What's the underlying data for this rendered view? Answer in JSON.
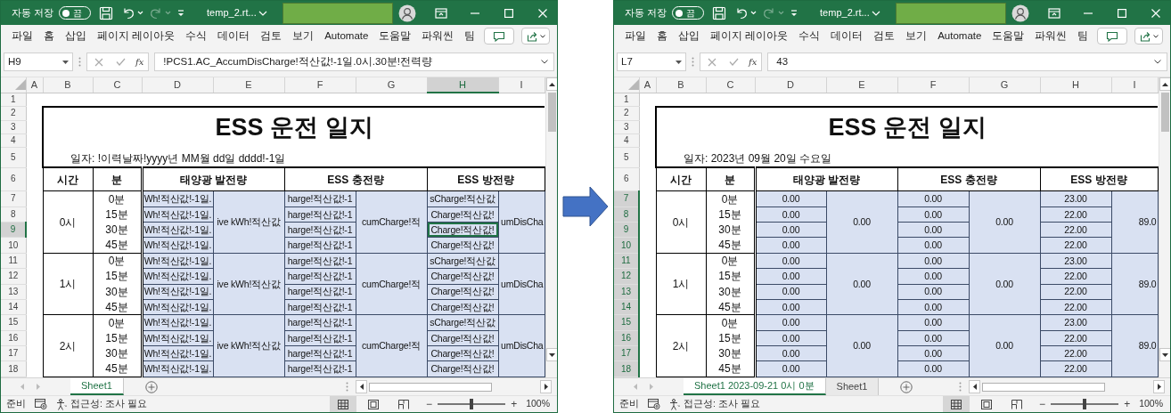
{
  "windows": [
    {
      "title_bar": {
        "autosave_label": "자동 저장",
        "autosave_state": "끔",
        "autosave_on": false,
        "redo_disabled": true,
        "filename": "temp_2.rt..."
      },
      "menu": [
        "파일",
        "홈",
        "삽입",
        "페이지 레이아웃",
        "수식",
        "데이터",
        "검토",
        "보기",
        "Automate",
        "도움말",
        "파워씬",
        "팀"
      ],
      "formula_bar": {
        "name_box": "H9",
        "fx": "fx",
        "formula": "!PCS1.AC_AccumDisCharge!적산값!-1일.0시.30분!전력량"
      },
      "columns": [
        {
          "label": "A",
          "selected": false
        },
        {
          "label": "B",
          "selected": false
        },
        {
          "label": "C",
          "selected": false
        },
        {
          "label": "D",
          "selected": false
        },
        {
          "label": "E",
          "selected": false
        },
        {
          "label": "F",
          "selected": false
        },
        {
          "label": "G",
          "selected": false
        },
        {
          "label": "H",
          "selected": true
        },
        {
          "label": "I",
          "selected": false
        }
      ],
      "rows": [
        {
          "label": "1",
          "selected": false
        },
        {
          "label": "2",
          "selected": false
        },
        {
          "label": "3",
          "selected": false
        },
        {
          "label": "4",
          "selected": false
        },
        {
          "label": "5",
          "selected": false
        },
        {
          "label": "6",
          "selected": false
        },
        {
          "label": "7",
          "selected": false
        },
        {
          "label": "8",
          "selected": false
        },
        {
          "label": "9",
          "selected": true
        },
        {
          "label": "10",
          "selected": false
        },
        {
          "label": "11",
          "selected": false
        },
        {
          "label": "12",
          "selected": false
        },
        {
          "label": "13",
          "selected": false
        },
        {
          "label": "14",
          "selected": false
        },
        {
          "label": "15",
          "selected": false
        },
        {
          "label": "16",
          "selected": false
        },
        {
          "label": "17",
          "selected": false
        },
        {
          "label": "18",
          "selected": false
        }
      ],
      "sheet": {
        "title": "ESS 운전 일지",
        "date_line": "일자: !이력날짜!yyyy년 MM월 dd일 dddd!-1일",
        "headers": [
          "시간",
          "분",
          "태양광 발전량",
          "ESS 충전량",
          "ESS 방전량"
        ],
        "groups": [
          {
            "hour": "0시",
            "totals": [
              "ive kWh!적산값",
              "cumCharge!적",
              "umDisCha"
            ],
            "quarters": [
              {
                "minute": "0분",
                "values": [
                  {
                    "text": "Wh!적산값!-1일.",
                    "active": false
                  },
                  {
                    "text": "harge!적산값!-1",
                    "active": false
                  },
                  {
                    "text": "sCharge!적산값",
                    "active": false
                  }
                ]
              },
              {
                "minute": "15분",
                "values": [
                  {
                    "text": "Wh!적산값!-1일.",
                    "active": false
                  },
                  {
                    "text": "harge!적산값!-1",
                    "active": false
                  },
                  {
                    "text": "Charge!적산값!",
                    "active": false
                  }
                ]
              },
              {
                "minute": "30분",
                "values": [
                  {
                    "text": "Wh!적산값!-1일.",
                    "active": false
                  },
                  {
                    "text": "harge!적산값!-1",
                    "active": false
                  },
                  {
                    "text": "Charge!적산값!",
                    "active": true
                  }
                ]
              },
              {
                "minute": "45분",
                "values": [
                  {
                    "text": "Wh!적산값!-1일.",
                    "active": false
                  },
                  {
                    "text": "harge!적산값!-1",
                    "active": false
                  },
                  {
                    "text": "Charge!적산값!",
                    "active": false
                  }
                ]
              }
            ]
          },
          {
            "hour": "1시",
            "totals": [
              "ive kWh!적산값",
              "cumCharge!적",
              "umDisCha"
            ],
            "quarters": [
              {
                "minute": "0분",
                "values": [
                  {
                    "text": "Wh!적산값!-1일.",
                    "active": false
                  },
                  {
                    "text": "harge!적산값!-1",
                    "active": false
                  },
                  {
                    "text": "sCharge!적산값",
                    "active": false
                  }
                ]
              },
              {
                "minute": "15분",
                "values": [
                  {
                    "text": "Wh!적산값!-1일.",
                    "active": false
                  },
                  {
                    "text": "harge!적산값!-1",
                    "active": false
                  },
                  {
                    "text": "Charge!적산값!",
                    "active": false
                  }
                ]
              },
              {
                "minute": "30분",
                "values": [
                  {
                    "text": "Wh!적산값!-1일.",
                    "active": false
                  },
                  {
                    "text": "harge!적산값!-1",
                    "active": false
                  },
                  {
                    "text": "Charge!적산값!",
                    "active": false
                  }
                ]
              },
              {
                "minute": "45분",
                "values": [
                  {
                    "text": "Wh!적산값!-1일.",
                    "active": false
                  },
                  {
                    "text": "harge!적산값!-1",
                    "active": false
                  },
                  {
                    "text": "Charge!적산값!",
                    "active": false
                  }
                ]
              }
            ]
          },
          {
            "hour": "2시",
            "totals": [
              "ive kWh!적산값",
              "cumCharge!적",
              "umDisCha"
            ],
            "quarters": [
              {
                "minute": "0분",
                "values": [
                  {
                    "text": "Wh!적산값!-1일.",
                    "active": false
                  },
                  {
                    "text": "harge!적산값!-1",
                    "active": false
                  },
                  {
                    "text": "sCharge!적산값",
                    "active": false
                  }
                ]
              },
              {
                "minute": "15분",
                "values": [
                  {
                    "text": "Wh!적산값!-1일.",
                    "active": false
                  },
                  {
                    "text": "harge!적산값!-1",
                    "active": false
                  },
                  {
                    "text": "Charge!적산값!",
                    "active": false
                  }
                ]
              },
              {
                "minute": "30분",
                "values": [
                  {
                    "text": "Wh!적산값!-1일.",
                    "active": false
                  },
                  {
                    "text": "harge!적산값!-1",
                    "active": false
                  },
                  {
                    "text": "Charge!적산값!",
                    "active": false
                  }
                ]
              },
              {
                "minute": "45분",
                "values": [
                  {
                    "text": "Wh!적산값!-1일.",
                    "active": false
                  },
                  {
                    "text": "harge!적산값!-1",
                    "active": false
                  },
                  {
                    "text": "Charge!적산값!",
                    "active": false
                  }
                ]
              }
            ]
          }
        ]
      },
      "sheet_tabs": [
        {
          "label": "Sheet1",
          "selected": true
        }
      ],
      "status_bar": {
        "ready": "준비",
        "accessibility": "접근성: 조사 필요",
        "views": [
          {
            "kind": "normal",
            "selected": true
          },
          {
            "kind": "page_layout",
            "selected": false
          },
          {
            "kind": "page_break",
            "selected": false
          }
        ],
        "zoom_minus": "−",
        "zoom_slider": {
          "level": 0.5
        },
        "zoom_plus": "+",
        "zoom_text": "100%"
      }
    },
    {
      "title_bar": {
        "autosave_label": "자동 저장",
        "autosave_state": "끔",
        "autosave_on": false,
        "redo_disabled": true,
        "filename": "temp_2.rt..."
      },
      "menu": [
        "파일",
        "홈",
        "삽입",
        "페이지 레이아웃",
        "수식",
        "데이터",
        "검토",
        "보기",
        "Automate",
        "도움말",
        "파워씬",
        "팀"
      ],
      "formula_bar": {
        "name_box": "L7",
        "fx": "fx",
        "formula": "43"
      },
      "columns": [
        {
          "label": "A",
          "selected": false
        },
        {
          "label": "B",
          "selected": false
        },
        {
          "label": "C",
          "selected": false
        },
        {
          "label": "D",
          "selected": false
        },
        {
          "label": "E",
          "selected": false
        },
        {
          "label": "F",
          "selected": false
        },
        {
          "label": "G",
          "selected": false
        },
        {
          "label": "H",
          "selected": false
        },
        {
          "label": "I",
          "selected": false
        }
      ],
      "rows": [
        {
          "label": "1",
          "selected": false
        },
        {
          "label": "2",
          "selected": false
        },
        {
          "label": "3",
          "selected": false
        },
        {
          "label": "4",
          "selected": false
        },
        {
          "label": "5",
          "selected": false
        },
        {
          "label": "6",
          "selected": false
        },
        {
          "label": "7",
          "selected": true
        },
        {
          "label": "8",
          "selected": true
        },
        {
          "label": "9",
          "selected": true
        },
        {
          "label": "10",
          "selected": true
        },
        {
          "label": "11",
          "selected": true
        },
        {
          "label": "12",
          "selected": true
        },
        {
          "label": "13",
          "selected": true
        },
        {
          "label": "14",
          "selected": true
        },
        {
          "label": "15",
          "selected": true
        },
        {
          "label": "16",
          "selected": true
        },
        {
          "label": "17",
          "selected": true
        },
        {
          "label": "18",
          "selected": true
        }
      ],
      "sheet": {
        "title": "ESS 운전 일지",
        "date_line": "일자: 2023년 09월 20일 수요일",
        "headers": [
          "시간",
          "분",
          "태양광 발전량",
          "ESS 충전량",
          "ESS 방전량"
        ],
        "groups": [
          {
            "hour": "0시",
            "totals": [
              "0.00",
              "0.00",
              "89.0"
            ],
            "quarters": [
              {
                "minute": "0분",
                "values": [
                  {
                    "text": "0.00",
                    "active": false
                  },
                  {
                    "text": "0.00",
                    "active": false
                  },
                  {
                    "text": "23.00",
                    "active": false
                  }
                ]
              },
              {
                "minute": "15분",
                "values": [
                  {
                    "text": "0.00",
                    "active": false
                  },
                  {
                    "text": "0.00",
                    "active": false
                  },
                  {
                    "text": "22.00",
                    "active": false
                  }
                ]
              },
              {
                "minute": "30분",
                "values": [
                  {
                    "text": "0.00",
                    "active": false
                  },
                  {
                    "text": "0.00",
                    "active": false
                  },
                  {
                    "text": "22.00",
                    "active": false
                  }
                ]
              },
              {
                "minute": "45분",
                "values": [
                  {
                    "text": "0.00",
                    "active": false
                  },
                  {
                    "text": "0.00",
                    "active": false
                  },
                  {
                    "text": "22.00",
                    "active": false
                  }
                ]
              }
            ]
          },
          {
            "hour": "1시",
            "totals": [
              "0.00",
              "0.00",
              "89.0"
            ],
            "quarters": [
              {
                "minute": "0분",
                "values": [
                  {
                    "text": "0.00",
                    "active": false
                  },
                  {
                    "text": "0.00",
                    "active": false
                  },
                  {
                    "text": "23.00",
                    "active": false
                  }
                ]
              },
              {
                "minute": "15분",
                "values": [
                  {
                    "text": "0.00",
                    "active": false
                  },
                  {
                    "text": "0.00",
                    "active": false
                  },
                  {
                    "text": "22.00",
                    "active": false
                  }
                ]
              },
              {
                "minute": "30분",
                "values": [
                  {
                    "text": "0.00",
                    "active": false
                  },
                  {
                    "text": "0.00",
                    "active": false
                  },
                  {
                    "text": "22.00",
                    "active": false
                  }
                ]
              },
              {
                "minute": "45분",
                "values": [
                  {
                    "text": "0.00",
                    "active": false
                  },
                  {
                    "text": "0.00",
                    "active": false
                  },
                  {
                    "text": "22.00",
                    "active": false
                  }
                ]
              }
            ]
          },
          {
            "hour": "2시",
            "totals": [
              "0.00",
              "0.00",
              "89.0"
            ],
            "quarters": [
              {
                "minute": "0분",
                "values": [
                  {
                    "text": "0.00",
                    "active": false
                  },
                  {
                    "text": "0.00",
                    "active": false
                  },
                  {
                    "text": "23.00",
                    "active": false
                  }
                ]
              },
              {
                "minute": "15분",
                "values": [
                  {
                    "text": "0.00",
                    "active": false
                  },
                  {
                    "text": "0.00",
                    "active": false
                  },
                  {
                    "text": "22.00",
                    "active": false
                  }
                ]
              },
              {
                "minute": "30분",
                "values": [
                  {
                    "text": "0.00",
                    "active": false
                  },
                  {
                    "text": "0.00",
                    "active": false
                  },
                  {
                    "text": "22.00",
                    "active": false
                  }
                ]
              },
              {
                "minute": "45분",
                "values": [
                  {
                    "text": "0.00",
                    "active": false
                  },
                  {
                    "text": "0.00",
                    "active": false
                  },
                  {
                    "text": "22.00",
                    "active": false
                  }
                ]
              }
            ]
          }
        ]
      },
      "sheet_tabs": [
        {
          "label": "Sheet1 2023-09-21 0시 0분",
          "selected": true
        },
        {
          "label": "Sheet1",
          "selected": false
        }
      ],
      "status_bar": {
        "ready": "준비",
        "accessibility": "접근성: 조사 필요",
        "views": [
          {
            "kind": "normal",
            "selected": true
          },
          {
            "kind": "page_layout",
            "selected": false
          },
          {
            "kind": "page_break",
            "selected": false
          }
        ],
        "zoom_minus": "−",
        "zoom_slider": {
          "level": 0.5
        },
        "zoom_plus": "+",
        "zoom_text": "100%"
      }
    }
  ]
}
